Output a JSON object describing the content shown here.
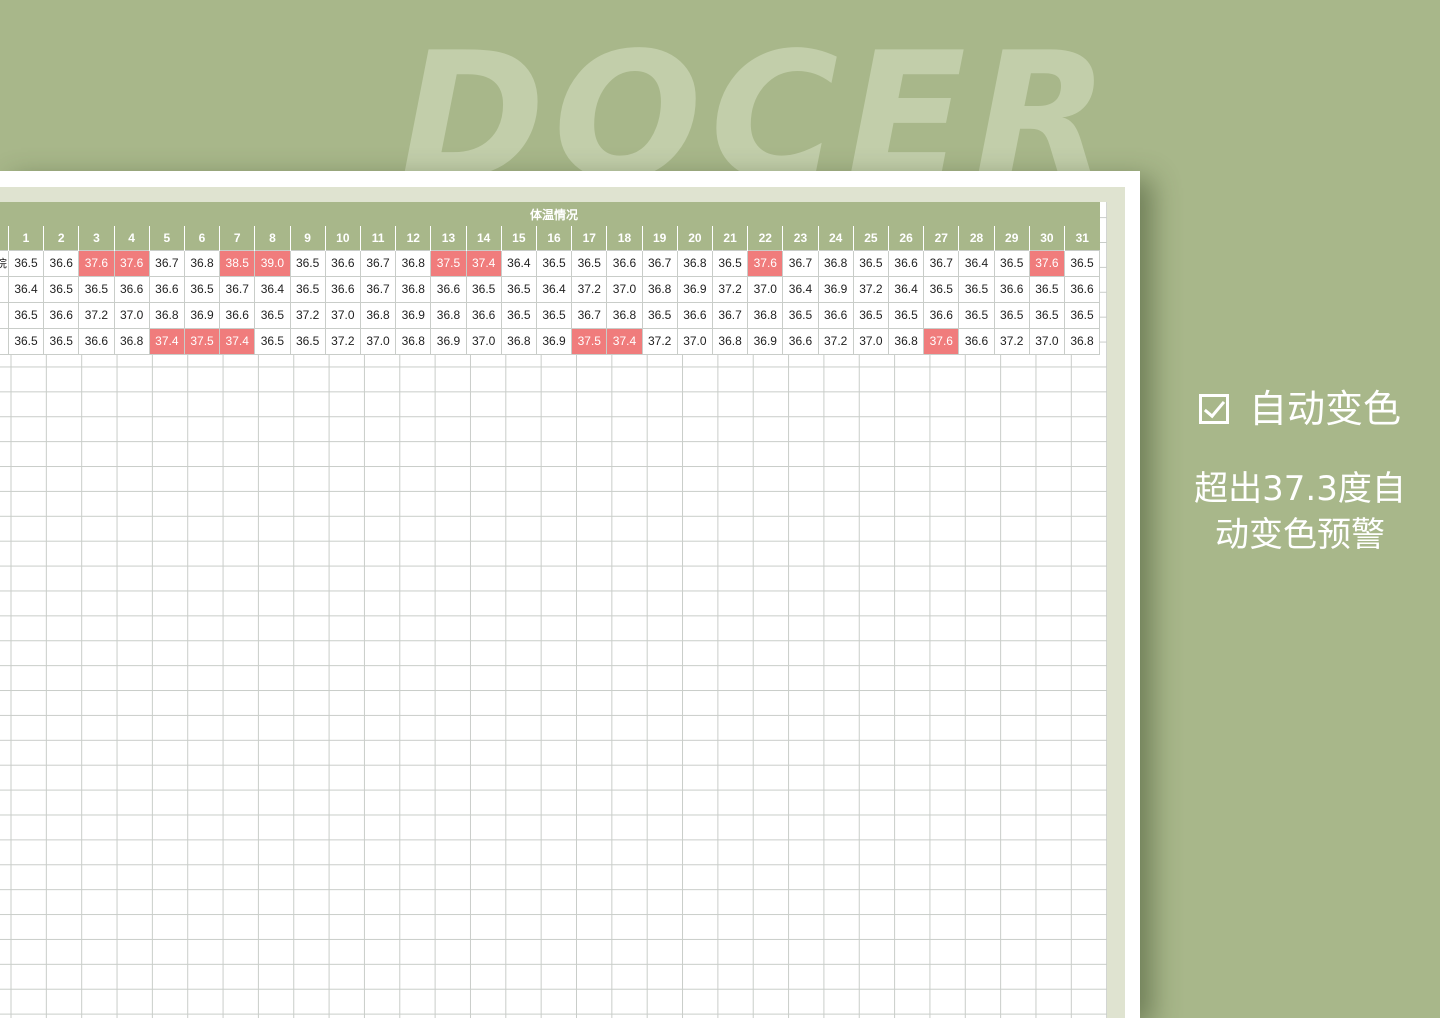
{
  "background": {
    "watermark": "DOCER",
    "color": "#a8b78a"
  },
  "sheet": {
    "section_title": "体温情况",
    "day_headers": [
      "1",
      "2",
      "3",
      "4",
      "5",
      "6",
      "7",
      "8",
      "9",
      "10",
      "11",
      "12",
      "13",
      "14",
      "15",
      "16",
      "17",
      "18",
      "19",
      "20",
      "21",
      "22",
      "23",
      "24",
      "25",
      "26",
      "27",
      "28",
      "29",
      "30",
      "31"
    ],
    "threshold": 37.3,
    "highlight_color": "#f07c7c",
    "rows": [
      {
        "name": "院",
        "values": [
          "36.5",
          "36.6",
          "37.6",
          "37.6",
          "36.7",
          "36.8",
          "38.5",
          "39.0",
          "36.5",
          "36.6",
          "36.7",
          "36.8",
          "37.5",
          "37.4",
          "36.4",
          "36.5",
          "36.5",
          "36.6",
          "36.7",
          "36.8",
          "36.5",
          "37.6",
          "36.7",
          "36.8",
          "36.5",
          "36.6",
          "36.7",
          "36.4",
          "36.5",
          "37.6",
          "36.5"
        ]
      },
      {
        "name": "",
        "values": [
          "36.4",
          "36.5",
          "36.5",
          "36.6",
          "36.6",
          "36.5",
          "36.7",
          "36.4",
          "36.5",
          "36.6",
          "36.7",
          "36.8",
          "36.6",
          "36.5",
          "36.5",
          "36.4",
          "37.2",
          "37.0",
          "36.8",
          "36.9",
          "37.2",
          "37.0",
          "36.4",
          "36.9",
          "37.2",
          "36.4",
          "36.5",
          "36.5",
          "36.6",
          "36.5",
          "36.6"
        ]
      },
      {
        "name": "",
        "values": [
          "36.5",
          "36.6",
          "37.2",
          "37.0",
          "36.8",
          "36.9",
          "36.6",
          "36.5",
          "37.2",
          "37.0",
          "36.8",
          "36.9",
          "36.8",
          "36.6",
          "36.5",
          "36.5",
          "36.7",
          "36.8",
          "36.5",
          "36.6",
          "36.7",
          "36.8",
          "36.5",
          "36.6",
          "36.5",
          "36.5",
          "36.6",
          "36.5",
          "36.5",
          "36.5",
          "36.5"
        ]
      },
      {
        "name": "",
        "values": [
          "36.5",
          "36.5",
          "36.6",
          "36.8",
          "37.4",
          "37.5",
          "37.4",
          "36.5",
          "36.5",
          "37.2",
          "37.0",
          "36.8",
          "36.9",
          "37.0",
          "36.8",
          "36.9",
          "37.5",
          "37.4",
          "37.2",
          "37.0",
          "36.8",
          "36.9",
          "36.6",
          "37.2",
          "37.0",
          "36.8",
          "37.6",
          "36.6",
          "37.2",
          "37.0",
          "36.8"
        ]
      }
    ]
  },
  "side": {
    "feature_title": "自动变色",
    "desc_line1": "超出37.3度自",
    "desc_line2": "动变色预警"
  }
}
